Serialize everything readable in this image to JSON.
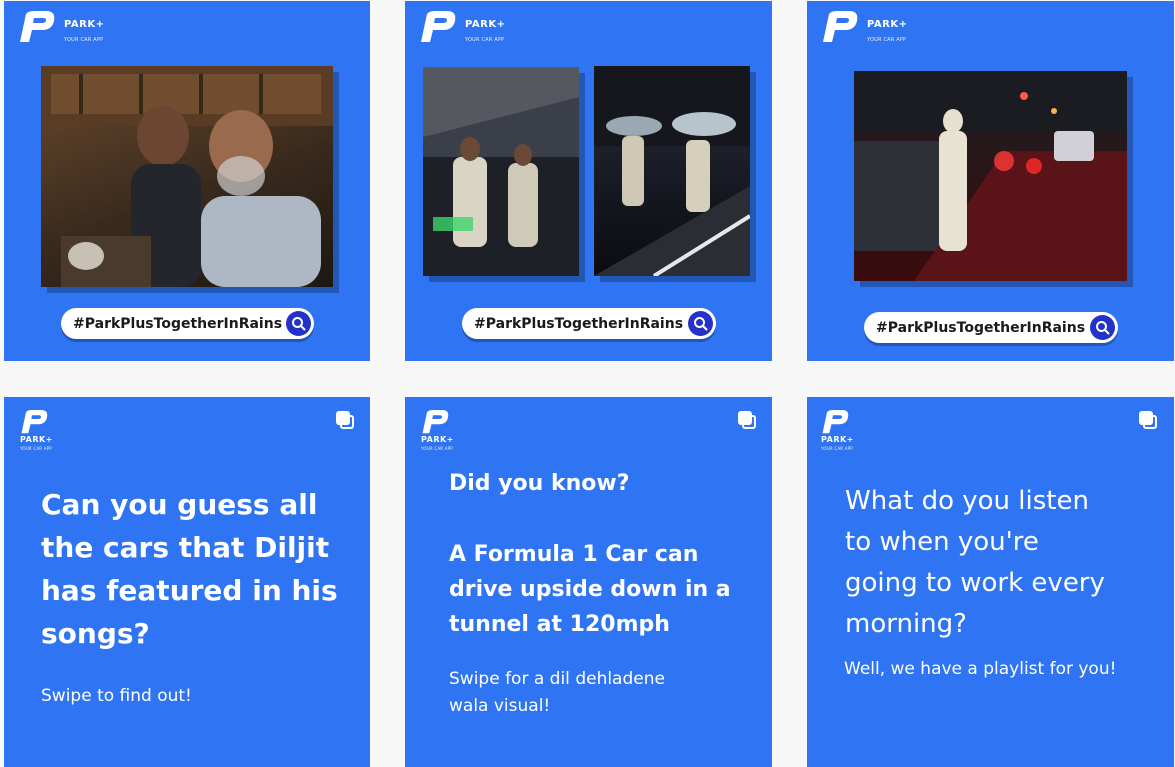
{
  "brand": {
    "name": "PARK+",
    "tagline": "YOUR CAR APP"
  },
  "hashtag": "#ParkPlusTogetherInRains",
  "colors": {
    "tile_blue": "#2f75f3",
    "search_button": "#2432c9",
    "page_bg": "#f7f7f7"
  },
  "icons": {
    "search": "search-icon",
    "carousel": "multiple-images-icon",
    "logo": "park-plus-logo-icon"
  },
  "posts": [
    {
      "type": "photo",
      "hashtag": "#ParkPlusTogetherInRains"
    },
    {
      "type": "photo",
      "hashtag": "#ParkPlusTogetherInRains"
    },
    {
      "type": "photo",
      "hashtag": "#ParkPlusTogetherInRains"
    },
    {
      "type": "carousel",
      "heading_lines": [
        "Can you guess all",
        "the cars that Diljit",
        "has featured in his",
        "songs?"
      ],
      "subtext_lines": [
        "Swipe to find out!"
      ]
    },
    {
      "type": "carousel",
      "intro": "Did you know?",
      "heading_lines": [
        "A Formula 1 Car can",
        "drive upside down in a",
        "tunnel at 120mph"
      ],
      "subtext_lines": [
        "Swipe for a dil dehladene",
        "wala visual!"
      ]
    },
    {
      "type": "carousel",
      "heading_lines": [
        "What do you listen",
        "to when you're",
        "going to work every",
        "morning?"
      ],
      "subtext_lines": [
        "Well, we have a playlist for you!"
      ]
    }
  ]
}
